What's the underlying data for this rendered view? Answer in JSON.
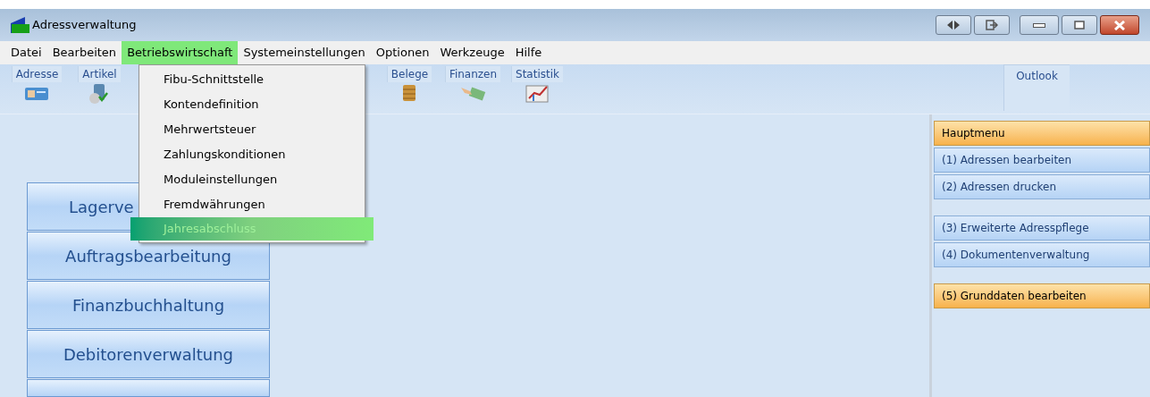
{
  "window": {
    "title": "Adressverwaltung"
  },
  "menu_bar": [
    {
      "label": "Datei",
      "selected": false
    },
    {
      "label": "Bearbeiten",
      "selected": false
    },
    {
      "label": "Betriebswirtschaft",
      "selected": true
    },
    {
      "label": "Systemeinstellungen",
      "selected": false
    },
    {
      "label": "Optionen",
      "selected": false
    },
    {
      "label": "Werkzeuge",
      "selected": false
    },
    {
      "label": "Hilfe",
      "selected": false
    }
  ],
  "dropdown": [
    {
      "label": "Fibu-Schnittstelle",
      "selected": false
    },
    {
      "label": "Kontendefinition",
      "selected": false
    },
    {
      "label": "Mehrwertsteuer",
      "selected": false
    },
    {
      "label": "Zahlungskonditionen",
      "selected": false
    },
    {
      "label": "Moduleinstellungen",
      "selected": false
    },
    {
      "label": "Fremdwährungen",
      "selected": false
    },
    {
      "label": "Jahresabschluss",
      "selected": true
    }
  ],
  "toolbar_tabs": [
    {
      "label": "Adresse",
      "selected": false
    },
    {
      "label": "Artikel",
      "selected": false
    },
    {
      "label": "Belege",
      "selected": false
    },
    {
      "label": "Finanzen",
      "selected": false
    },
    {
      "label": "Statistik",
      "selected": false
    }
  ],
  "outlook_tab": {
    "label": "Outlook",
    "selected": true
  },
  "modules": [
    {
      "label": "Lagerve",
      "covered": true
    },
    {
      "label": "Auftragsbearbeitung",
      "covered": false
    },
    {
      "label": "Finanzbuchhaltung",
      "covered": false
    },
    {
      "label": "Debitorenverwaltung",
      "covered": false
    }
  ],
  "side_menu_groups": [
    [
      {
        "label": "Hauptmenu",
        "kind": "header"
      },
      {
        "label": "(1) Adressen bearbeiten",
        "kind": "item"
      },
      {
        "label": "(2) Adressen drucken",
        "kind": "item"
      }
    ],
    [
      {
        "label": "(3) Erweiterte Adresspflege",
        "kind": "item"
      },
      {
        "label": "(4) Dokumentenverwaltung",
        "kind": "item"
      }
    ],
    [
      {
        "label": "(5) Grunddaten bearbeiten",
        "kind": "header"
      }
    ]
  ]
}
